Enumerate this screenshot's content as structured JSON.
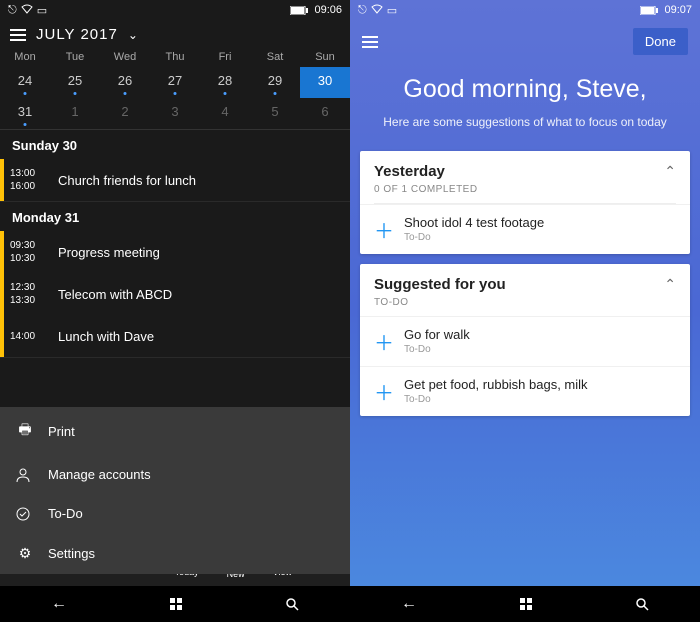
{
  "left": {
    "status": {
      "time": "09:06"
    },
    "title": "JULY 2017",
    "weekdays": [
      "Mon",
      "Tue",
      "Wed",
      "Thu",
      "Fri",
      "Sat",
      "Sun"
    ],
    "rows": [
      [
        {
          "n": "24",
          "dot": true
        },
        {
          "n": "25",
          "dot": true
        },
        {
          "n": "26",
          "dot": true
        },
        {
          "n": "27",
          "dot": true
        },
        {
          "n": "28",
          "dot": true
        },
        {
          "n": "29",
          "dot": true
        },
        {
          "n": "30",
          "dot": false,
          "sel": true
        }
      ],
      [
        {
          "n": "31",
          "dot": true
        },
        {
          "n": "1",
          "dim": true
        },
        {
          "n": "2",
          "dim": true
        },
        {
          "n": "3",
          "dim": true
        },
        {
          "n": "4",
          "dim": true
        },
        {
          "n": "5",
          "dim": true
        },
        {
          "n": "6",
          "dim": true
        }
      ]
    ],
    "agenda": [
      {
        "day": "Sunday 30",
        "events": [
          {
            "from": "13:00",
            "to": "16:00",
            "title": "Church friends for lunch"
          }
        ]
      },
      {
        "day": "Monday 31",
        "events": [
          {
            "from": "09:30",
            "to": "10:30",
            "title": "Progress meeting"
          },
          {
            "from": "12:30",
            "to": "13:30",
            "title": "Telecom with ABCD"
          },
          {
            "from": "14:00",
            "to": "",
            "title": "Lunch with Dave"
          }
        ]
      }
    ],
    "menu": [
      {
        "icon": "print",
        "label": "Print"
      },
      {
        "icon": "person",
        "label": "Manage accounts"
      },
      {
        "icon": "check",
        "label": "To-Do"
      },
      {
        "icon": "gear",
        "label": "Settings"
      }
    ],
    "appbar": {
      "today": "Today",
      "new": "New",
      "view": "View"
    }
  },
  "right": {
    "status": {
      "time": "09:07"
    },
    "done": "Done",
    "greeting_title": "Good morning, Steve,",
    "greeting_sub": "Here are some suggestions of what to focus on today",
    "card1": {
      "title": "Yesterday",
      "sub": "0 OF 1 COMPLETED",
      "items": [
        {
          "title": "Shoot idol 4 test footage",
          "sub": "To-Do"
        }
      ]
    },
    "card2": {
      "title": "Suggested for you",
      "sub": "TO-DO",
      "items": [
        {
          "title": "Go for walk",
          "sub": "To-Do"
        },
        {
          "title": "Get pet food, rubbish bags, milk",
          "sub": "To-Do"
        }
      ]
    }
  }
}
